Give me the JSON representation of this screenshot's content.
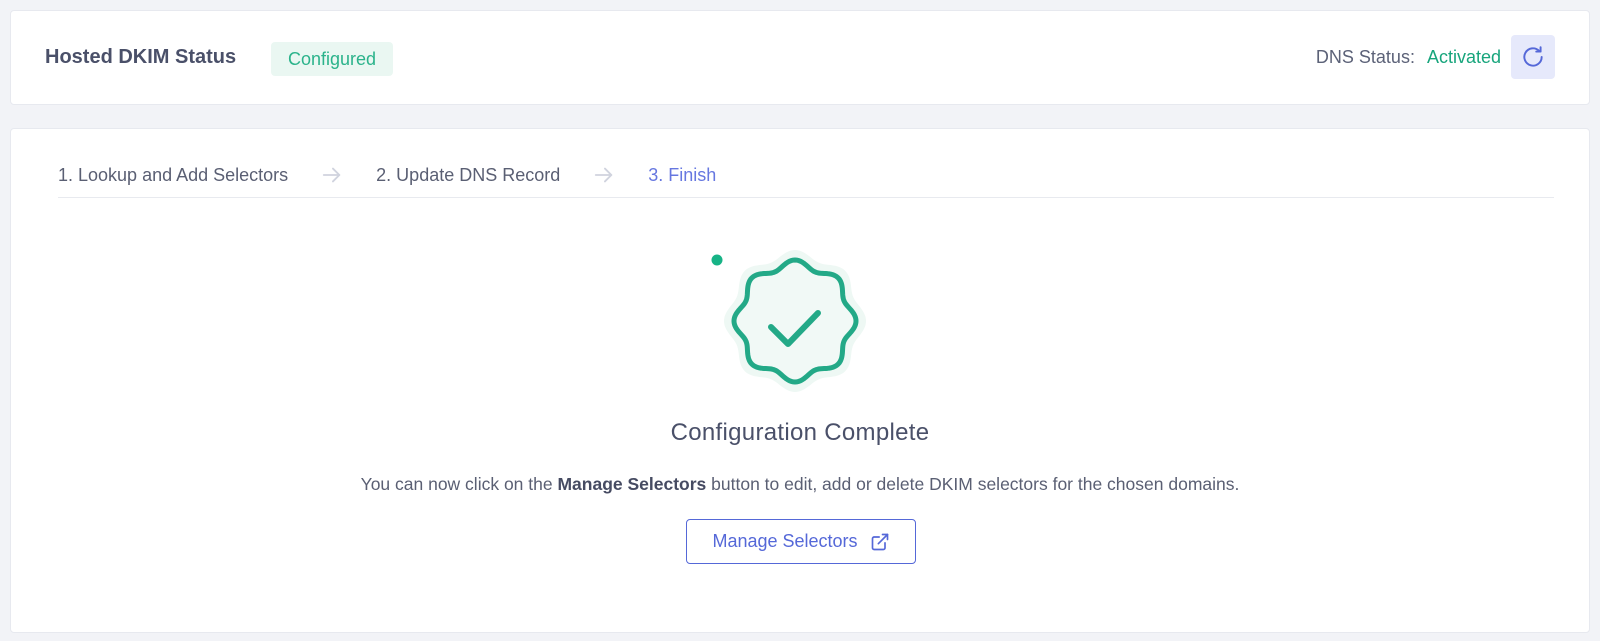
{
  "header": {
    "title": "Hosted DKIM Status",
    "badge": "Configured",
    "dns_status_label": "DNS Status:",
    "dns_status_value": "Activated",
    "refresh_icon": "refresh-icon"
  },
  "steps": [
    {
      "label": "1. Lookup and Add Selectors",
      "active": false
    },
    {
      "label": "2. Update DNS Record",
      "active": false
    },
    {
      "label": "3. Finish",
      "active": true
    }
  ],
  "main": {
    "success_icon": "verified-badge-icon",
    "title": "Configuration Complete",
    "description_before": "You can now click on the ",
    "description_bold": "Manage Selectors",
    "description_after": " button to edit, add or delete DKIM selectors for the chosen domains.",
    "button_label": "Manage Selectors",
    "button_icon": "external-link-icon"
  },
  "colors": {
    "accent": "#5568d8",
    "success": "#17a57c",
    "badge_bg": "#eaf7f2",
    "badge_text": "#2bb38b",
    "active_step": "#6677e0"
  }
}
